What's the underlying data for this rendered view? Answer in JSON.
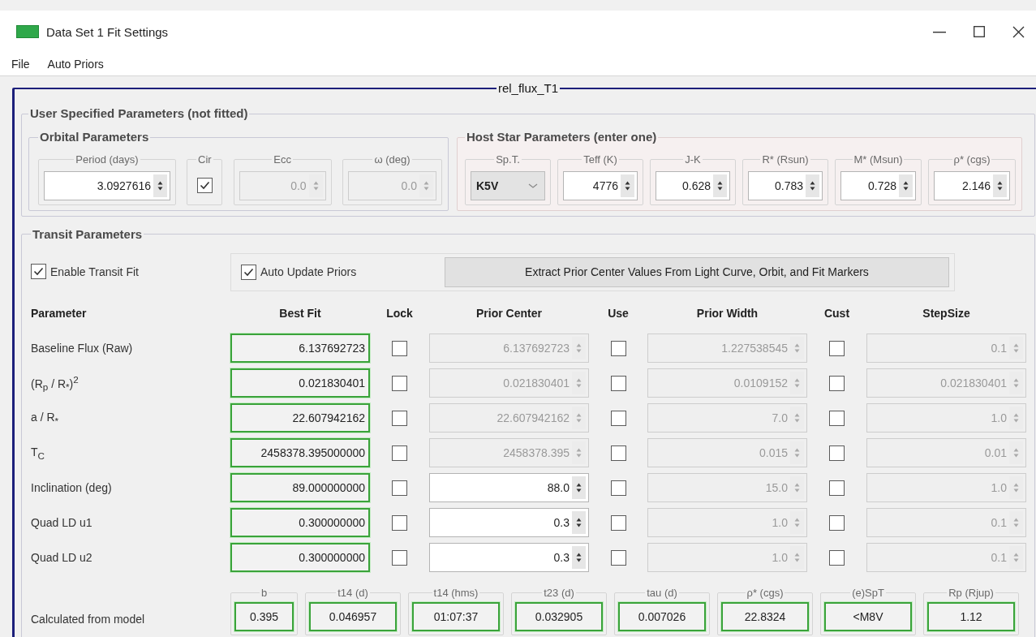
{
  "window": {
    "title": "Data Set 1 Fit Settings"
  },
  "menu": [
    "File",
    "Auto Priors"
  ],
  "dataset": {
    "title": "rel_flux_T1"
  },
  "user_params": {
    "title": "User Specified Parameters (not fitted)",
    "orbital": {
      "title": "Orbital Parameters",
      "fields": [
        {
          "kind": "spin",
          "label": "Period (days)",
          "value": "3.0927616",
          "disabled": false
        },
        {
          "kind": "check",
          "label": "Cir",
          "checked": true
        },
        {
          "kind": "spin",
          "label": "Ecc",
          "value": "0.0",
          "disabled": true
        },
        {
          "kind": "spin",
          "label": "ω (deg)",
          "value": "0.0",
          "disabled": true
        }
      ]
    },
    "host_star": {
      "title": "Host Star Parameters (enter one)",
      "fields": [
        {
          "kind": "combo",
          "label": "Sp.T.",
          "value": "K5V"
        },
        {
          "kind": "spin",
          "label": "Teff (K)",
          "value": "4776",
          "disabled": false
        },
        {
          "kind": "spin",
          "label": "J-K",
          "value": "0.628",
          "disabled": false
        },
        {
          "kind": "spin",
          "label": "R* (Rsun)",
          "value": "0.783",
          "disabled": false
        },
        {
          "kind": "spin",
          "label": "M* (Msun)",
          "value": "0.728",
          "disabled": false
        },
        {
          "kind": "spin",
          "label": "ρ* (cgs)",
          "value": "2.146",
          "disabled": false
        }
      ]
    }
  },
  "transit": {
    "title": "Transit Parameters",
    "enable_fit": {
      "label": "Enable Transit Fit",
      "checked": true
    },
    "auto_update": {
      "label": "Auto Update Priors",
      "checked": true
    },
    "extract_button": "Extract Prior Center Values From Light Curve, Orbit, and Fit Markers",
    "columns": [
      "Parameter",
      "Best Fit",
      "Lock",
      "Prior Center",
      "Use",
      "Prior Width",
      "Cust",
      "StepSize"
    ],
    "rows": [
      {
        "name": "Baseline Flux (Raw)",
        "best_fit": "6.137692723",
        "lock": false,
        "prior_center": {
          "value": "6.137692723",
          "disabled": true
        },
        "use": false,
        "prior_width": {
          "value": "1.227538545",
          "disabled": true
        },
        "cust": false,
        "step_size": {
          "value": "0.1",
          "disabled": true
        }
      },
      {
        "name": "(R$_{p}$ / R$_{*}$)$^{2}$",
        "best_fit": "0.021830401",
        "lock": false,
        "prior_center": {
          "value": "0.021830401",
          "disabled": true
        },
        "use": false,
        "prior_width": {
          "value": "0.0109152",
          "disabled": true
        },
        "cust": false,
        "step_size": {
          "value": "0.021830401",
          "disabled": true
        }
      },
      {
        "name": "a / R$_{*}$",
        "best_fit": "22.607942162",
        "lock": false,
        "prior_center": {
          "value": "22.607942162",
          "disabled": true
        },
        "use": false,
        "prior_width": {
          "value": "7.0",
          "disabled": true
        },
        "cust": false,
        "step_size": {
          "value": "1.0",
          "disabled": true
        }
      },
      {
        "name": "T$_{C}$",
        "best_fit": "2458378.395000000",
        "lock": false,
        "prior_center": {
          "value": "2458378.395",
          "disabled": true
        },
        "use": false,
        "prior_width": {
          "value": "0.015",
          "disabled": true
        },
        "cust": false,
        "step_size": {
          "value": "0.01",
          "disabled": true
        }
      },
      {
        "name": "Inclination (deg)",
        "best_fit": "89.000000000",
        "lock": false,
        "prior_center": {
          "value": "88.0",
          "disabled": false
        },
        "use": false,
        "prior_width": {
          "value": "15.0",
          "disabled": true
        },
        "cust": false,
        "step_size": {
          "value": "1.0",
          "disabled": true
        }
      },
      {
        "name": "Quad LD u1",
        "best_fit": "0.300000000",
        "lock": false,
        "prior_center": {
          "value": "0.3",
          "disabled": false
        },
        "use": false,
        "prior_width": {
          "value": "1.0",
          "disabled": true
        },
        "cust": false,
        "step_size": {
          "value": "0.1",
          "disabled": true
        }
      },
      {
        "name": "Quad LD u2",
        "best_fit": "0.300000000",
        "lock": false,
        "prior_center": {
          "value": "0.3",
          "disabled": false
        },
        "use": false,
        "prior_width": {
          "value": "1.0",
          "disabled": true
        },
        "cust": false,
        "step_size": {
          "value": "0.1",
          "disabled": true
        }
      }
    ],
    "calculated": {
      "label": "Calculated from model",
      "values": [
        {
          "label": "b",
          "value": "0.395"
        },
        {
          "label": "t14 (d)",
          "value": "0.046957"
        },
        {
          "label": "t14 (hms)",
          "value": "01:07:37"
        },
        {
          "label": "t23 (d)",
          "value": "0.032905"
        },
        {
          "label": "tau (d)",
          "value": "0.007026"
        },
        {
          "label": "ρ* (cgs)",
          "value": "22.8324"
        },
        {
          "label": "(e)SpT",
          "value": "<M8V"
        },
        {
          "label": "Rp (Rjup)",
          "value": "1.12"
        }
      ]
    }
  }
}
